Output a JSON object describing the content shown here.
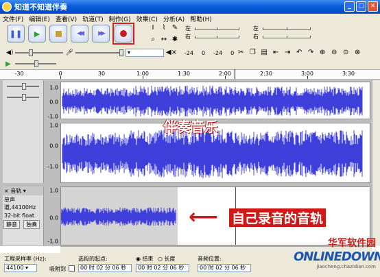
{
  "window": {
    "title": "知道不知道伴奏"
  },
  "menu": [
    "文件(F)",
    "编辑(E)",
    "查看(V)",
    "轨道(T)",
    "制作(G)",
    "效果(C)",
    "分析(A)",
    "帮助(H)"
  ],
  "meter": {
    "left_ch": "左",
    "right_ch": "右",
    "top_scale": [
      "-24",
      "0"
    ],
    "right_scale": [
      "-24",
      "0"
    ],
    "bottom_scale": [
      "-24",
      "-12",
      "0"
    ]
  },
  "ruler": {
    "ticks": [
      "-30",
      "0",
      "30",
      "1:00",
      "1:30",
      "2:00",
      "2:30",
      "3:00",
      "3:30"
    ]
  },
  "tracks": {
    "top": {
      "scale_upper": [
        "1.0",
        "0.0",
        "-1.0"
      ],
      "scale_lower": [
        "1.0",
        "0.0",
        "-1.0"
      ]
    },
    "bottom": {
      "name": "音轨",
      "info1": "单声道,44100Hz",
      "info2": "32-bit float",
      "mute": "静音",
      "solo": "独奏",
      "scale": [
        "1.0",
        "0.0",
        "-1.0"
      ]
    }
  },
  "annotations": {
    "accompaniment": "伴奏音乐",
    "own_recording": "自己录音的音轨"
  },
  "selection_bar": {
    "rate_label": "工程采样率 (Hz):",
    "rate_value": "44100",
    "snap_label": "吸附到",
    "start_label": "选段的起点:",
    "start_value": "00 时 02 分 06 秒",
    "end_radio": "结束",
    "length_radio": "长度",
    "end_value": "00 时 02 分 06 秒",
    "audio_pos_label": "音频位置:",
    "audio_pos_value": "00 时 02 分 06 秒"
  },
  "watermark": {
    "cn": "华军软件园",
    "en": "ONLINEDOWN",
    "url": "jiaocheng.chazidian.com"
  },
  "colors": {
    "waveform": "#3f3fdc",
    "record_highlight": "#d02020",
    "title_bar": "#0a5fd8"
  }
}
